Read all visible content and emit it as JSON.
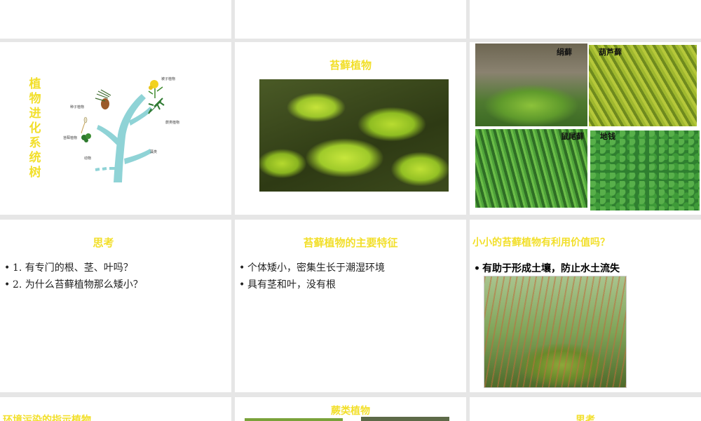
{
  "tree_slide": {
    "title": "植物进化系统树",
    "labels": {
      "seed": "种子植物",
      "bryophyte": "苔藓植物",
      "animal": "动物",
      "angiosperm": "被子植物",
      "fern": "蕨类植物",
      "algae": "藻类"
    }
  },
  "moss_slide": {
    "title": "苔藓植物"
  },
  "moss_types": [
    "绢藓",
    "葫芦藓",
    "鼠尾藓",
    "地钱"
  ],
  "think_slide": {
    "title": "思考",
    "items": [
      "1. 有专门的根、茎、叶吗？",
      "2. 为什么苔藓植物那么矮小？"
    ]
  },
  "features_slide": {
    "title": "苔藓植物的主要特征",
    "items": [
      "个体矮小，密集生长于潮湿环境",
      "具有茎和叶，没有根"
    ]
  },
  "value_slide": {
    "title": "小小的苔藓植物有利用价值吗？",
    "items": [
      "有助于形成土壤，防止水土流失"
    ]
  },
  "bottom_row": {
    "left_title": "环境污染的指示植物",
    "mid_title": "蕨类植物",
    "right_title": "思考"
  },
  "colors": {
    "title_yellow": "#f2df2a",
    "background": "#e6e6e6",
    "tree": "#8fd3d6"
  }
}
